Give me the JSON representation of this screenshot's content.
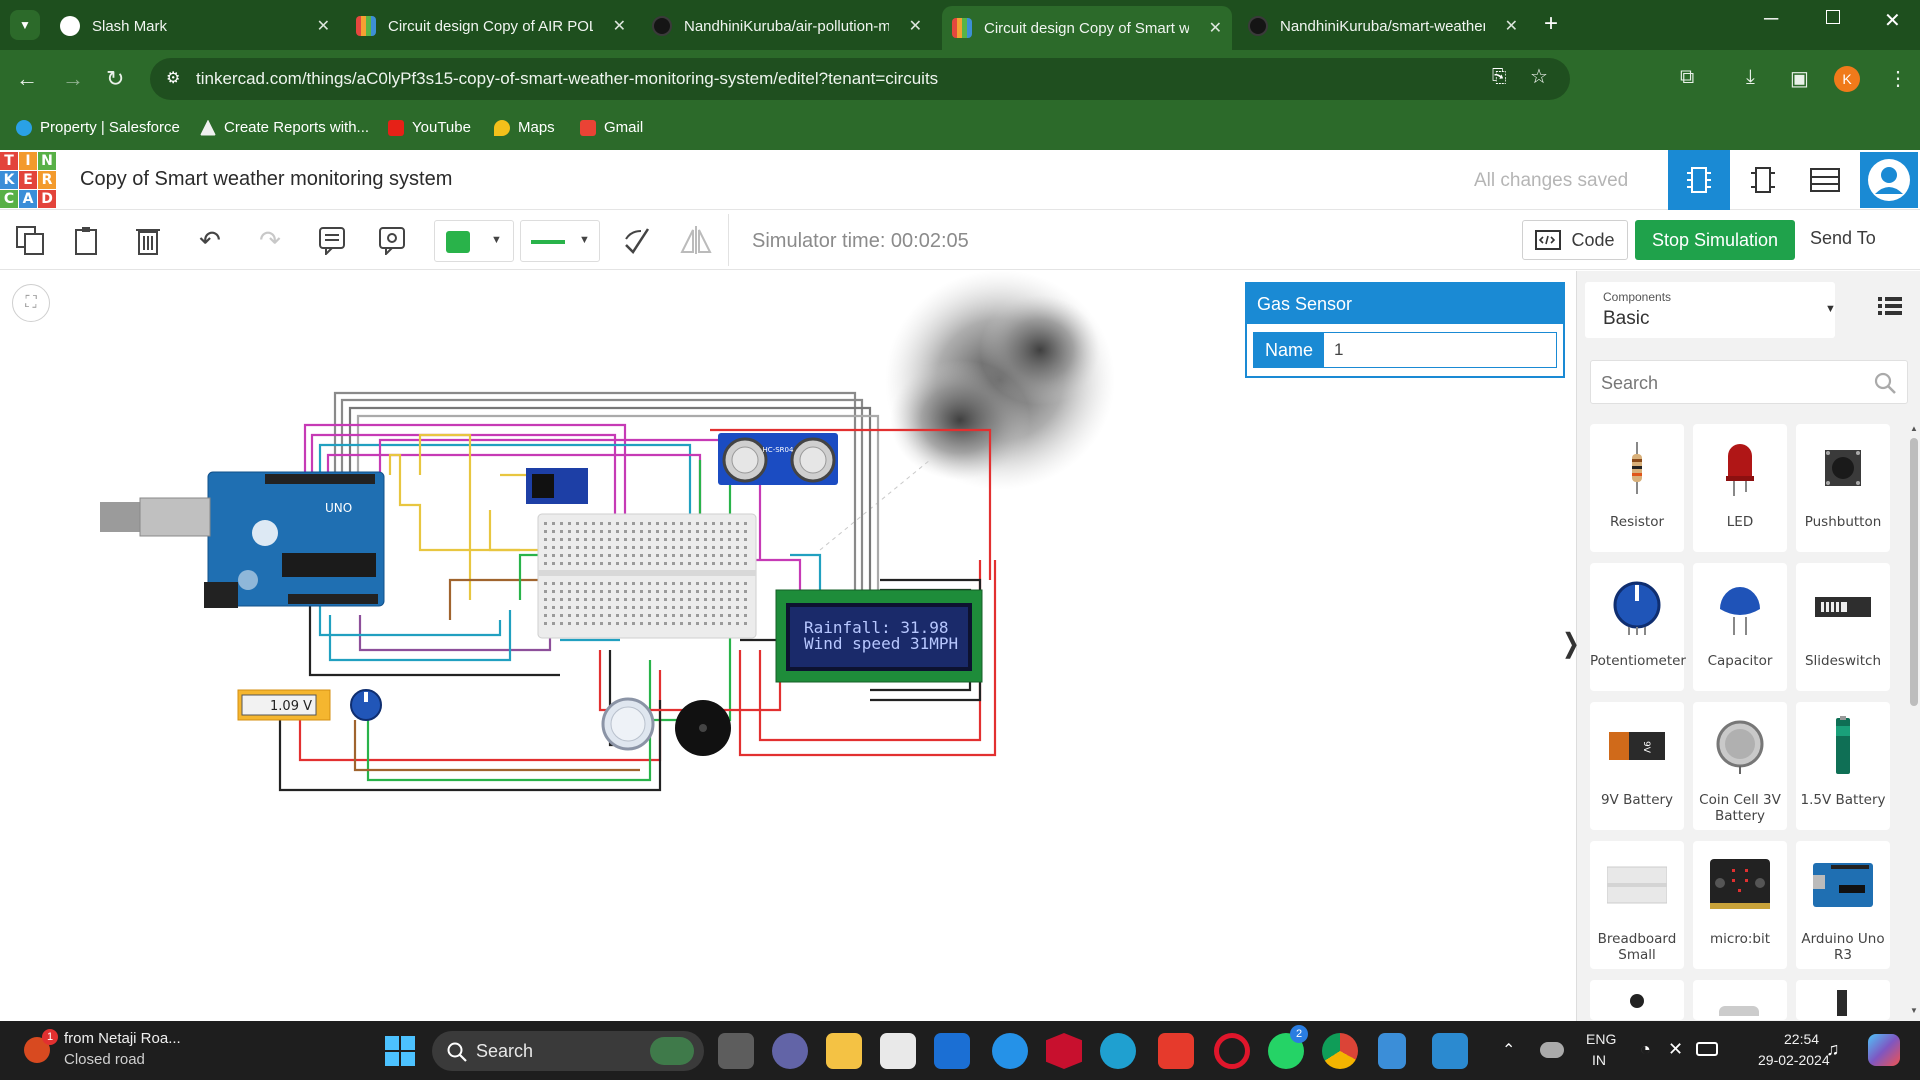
{
  "browser": {
    "tabs": [
      {
        "title": "Slash Mark",
        "active": false
      },
      {
        "title": "Circuit design Copy of AIR POLL",
        "active": false
      },
      {
        "title": "NandhiniKuruba/air-pollution-m",
        "active": false
      },
      {
        "title": "Circuit design Copy of Smart we",
        "active": true
      },
      {
        "title": "NandhiniKuruba/smart-weather",
        "active": false
      }
    ],
    "url": "tinkercad.com/things/aC0lyPf3s15-copy-of-smart-weather-monitoring-system/editel?tenant=circuits",
    "profile_initial": "K",
    "bookmarks": [
      {
        "label": "Property | Salesforce"
      },
      {
        "label": "Create Reports with..."
      },
      {
        "label": "YouTube"
      },
      {
        "label": "Maps"
      },
      {
        "label": "Gmail"
      }
    ]
  },
  "app": {
    "logo_letters": [
      "T",
      "I",
      "N",
      "K",
      "E",
      "R",
      "C",
      "A",
      "D"
    ],
    "project_title": "Copy of Smart weather monitoring system",
    "save_status": "All changes saved"
  },
  "toolbar": {
    "sim_time": "Simulator time: 00:02:05",
    "code_label": "Code",
    "stop_label": "Stop Simulation",
    "send_label": "Send To",
    "wire_color": "#29b34a"
  },
  "inspector": {
    "header": "Gas Sensor",
    "field_label": "Name",
    "field_value": "1"
  },
  "circuit": {
    "lcd_line1": "Rainfall: 31.98",
    "lcd_line2": "Wind speed 31MPH",
    "multimeter": "1.09 V",
    "ultrasonic_label": "HC-SR04",
    "arduino_label": "UNO"
  },
  "panel": {
    "components_label": "Components",
    "components_value": "Basic",
    "search_placeholder": "Search",
    "components": [
      {
        "name": "Resistor",
        "icon": "resistor-icon"
      },
      {
        "name": "LED",
        "icon": "led-icon"
      },
      {
        "name": "Pushbutton",
        "icon": "pushbutton-icon"
      },
      {
        "name": "Potentiometer",
        "icon": "potentiometer-icon"
      },
      {
        "name": "Capacitor",
        "icon": "capacitor-icon"
      },
      {
        "name": "Slideswitch",
        "icon": "slideswitch-icon"
      },
      {
        "name": "9V Battery",
        "icon": "battery-9v-icon"
      },
      {
        "name": "Coin Cell 3V Battery",
        "icon": "coin-cell-icon"
      },
      {
        "name": "1.5V Battery",
        "icon": "battery-aa-icon"
      },
      {
        "name": "Breadboard Small",
        "icon": "breadboard-icon"
      },
      {
        "name": "micro:bit",
        "icon": "microbit-icon"
      },
      {
        "name": "Arduino Uno R3",
        "icon": "arduino-icon"
      }
    ]
  },
  "taskbar": {
    "notification_title": "from Netaji Roa...",
    "notification_sub": "Closed road",
    "search_label": "Search",
    "lang_top": "ENG",
    "lang_bottom": "IN",
    "time": "22:54",
    "date": "29-02-2024",
    "whatsapp_badge": "2"
  }
}
